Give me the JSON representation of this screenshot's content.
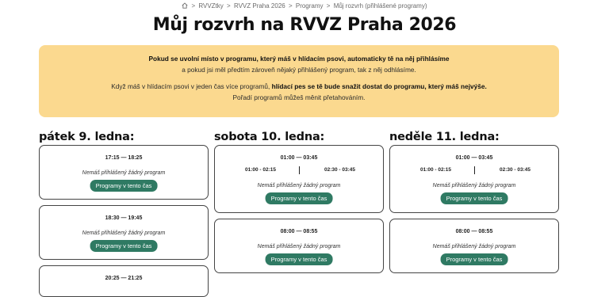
{
  "breadcrumb": {
    "items": [
      "RVVZtky",
      "RVVZ Praha 2026",
      "Programy",
      "Můj rozvrh (přihlášené programy)"
    ],
    "separator": ">"
  },
  "title": "Můj rozvrh na RVVZ Praha 2026",
  "notice": {
    "line1": "Pokud se uvolní místo v programu, který máš v hlídacím psovi, automaticky tě na něj přihlásíme",
    "line2": "a pokud jsi měl předtím zároveň nějaký přihlášený program, tak z něj odhlásíme.",
    "line3_pre": "Když máš v hlídacím psovi v jeden čas více programů, ",
    "line3_bold": "hlídací pes se tě bude snažit dostat do programu, který máš nejvýše.",
    "line4": "Pořadí programů můžeš měnit přetahováním."
  },
  "empty_text": "Nemáš přihlášený žádný program",
  "button_label": "Programy v tento čas",
  "days": [
    {
      "label": "pátek 9. ledna:",
      "slots": [
        {
          "time": "17:15 — 18:25"
        },
        {
          "time": "18:30 — 19:45"
        },
        {
          "time": "20:25 — 21:25"
        }
      ]
    },
    {
      "label": "sobota 10. ledna:",
      "slots": [
        {
          "time": "01:00 — 03:45",
          "sub_left": "01:00 - 02:15",
          "sub_right": "02:30 - 03:45"
        },
        {
          "time": "08:00 — 08:55"
        }
      ]
    },
    {
      "label": "neděle 11. ledna:",
      "slots": [
        {
          "time": "01:00 — 03:45",
          "sub_left": "01:00 - 02:15",
          "sub_right": "02:30 - 03:45"
        },
        {
          "time": "08:00 — 08:55"
        }
      ]
    }
  ],
  "colors": {
    "notice_bg": "#fbd98f",
    "button_bg": "#2f7a63"
  },
  "icons": {
    "home": "home-icon"
  }
}
